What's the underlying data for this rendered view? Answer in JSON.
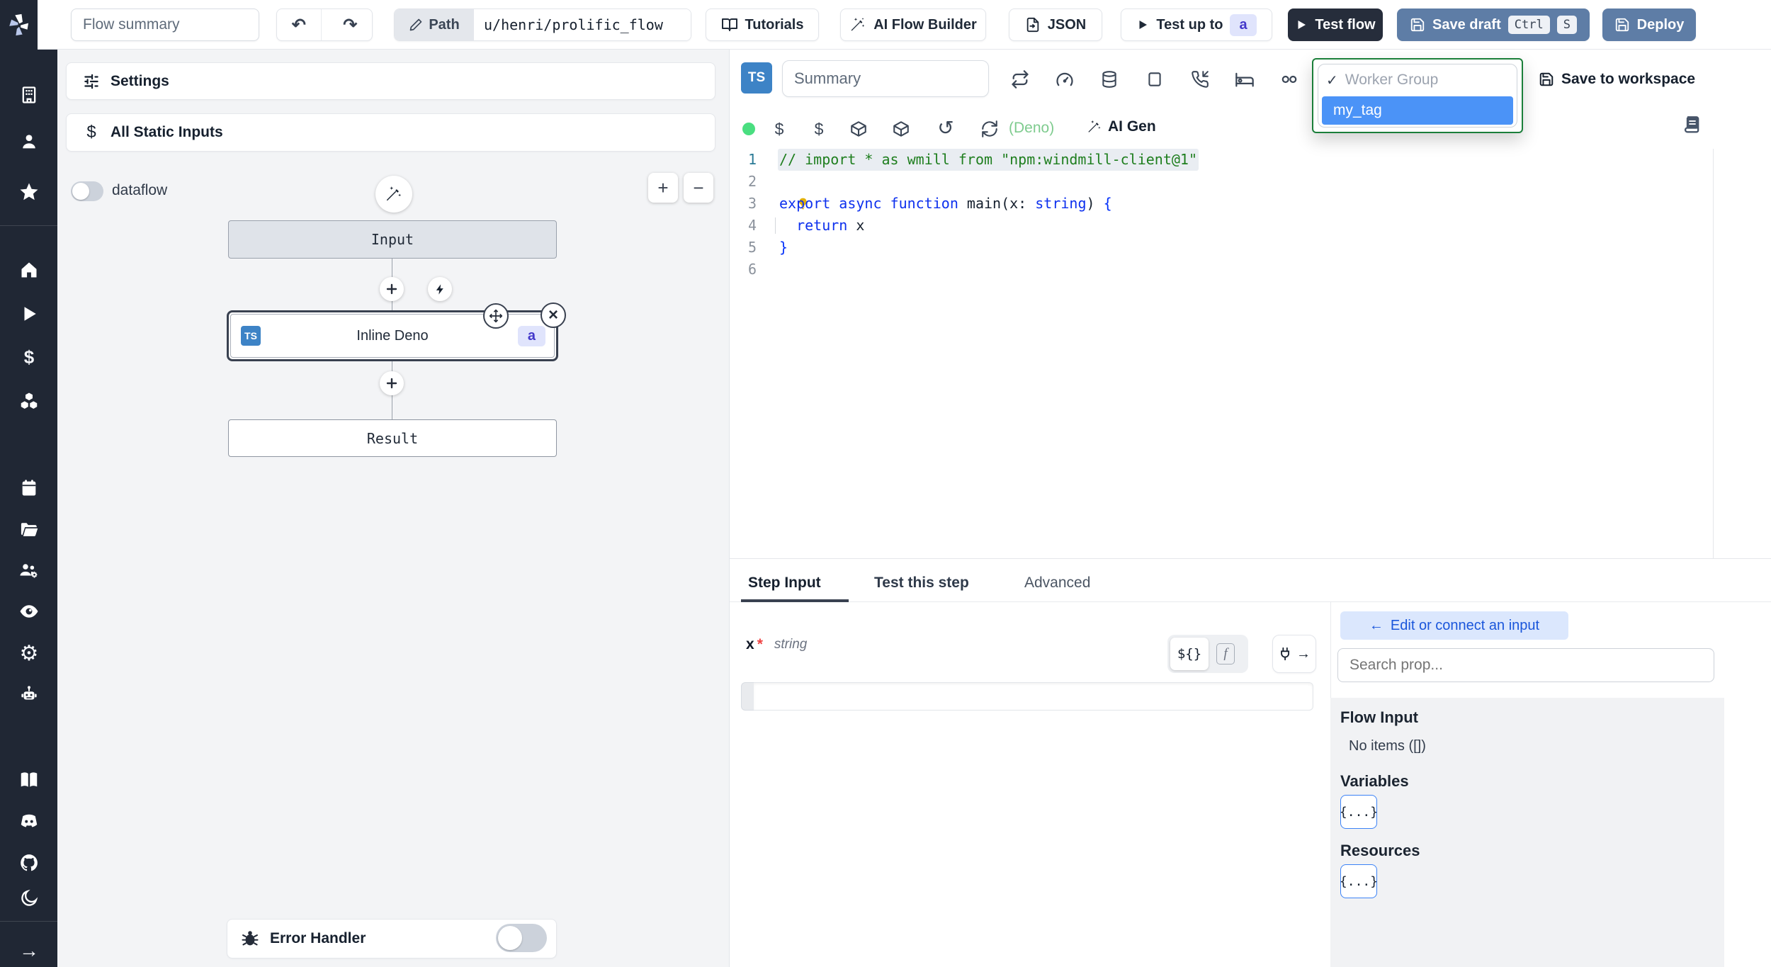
{
  "glyphs": {
    "undo": "↶",
    "redo": "↷",
    "check": "✓",
    "arrow_left": "←",
    "arrow_right": "→",
    "close": "×",
    "dollar": "$",
    "gear": "⚙",
    "moon": "☾",
    "rotate_ccw": "↺",
    "plus": "+",
    "minus": "−"
  },
  "topbar": {
    "flow_summary_placeholder": "Flow summary",
    "path_label": "Path",
    "path_value": "u/henri/prolific_flow",
    "tutorials": "Tutorials",
    "ai_flow_builder": "AI Flow Builder",
    "json": "JSON",
    "test_up_to": "Test up to",
    "test_up_to_badge": "a",
    "test_flow": "Test flow",
    "save_draft": "Save draft",
    "kbd_ctrl": "Ctrl",
    "kbd_s": "S",
    "deploy": "Deploy"
  },
  "sidebar": {
    "icon_names": [
      "windmill-logo",
      "building",
      "user",
      "star",
      "home",
      "play",
      "dollar",
      "boxes",
      "calendar",
      "folder",
      "user-group-gear",
      "eye",
      "gear",
      "robot",
      "book",
      "discord",
      "github",
      "moon",
      "expand-arrow"
    ]
  },
  "flow": {
    "settings": "Settings",
    "all_static_inputs": "All Static Inputs",
    "dataflow_label": "dataflow",
    "input_node": "Input",
    "deno_node": "Inline Deno",
    "deno_lang_badge": "TS",
    "deno_badge": "a",
    "result_node": "Result",
    "error_handler": "Error Handler"
  },
  "editor": {
    "lang_badge": "TS",
    "summary_placeholder": "Summary",
    "dropdown": {
      "group": "Worker Group",
      "selected": "my_tag"
    },
    "save_to_workspace": "Save to workspace",
    "lang_hint": "(Deno)",
    "ai_gen": "AI Gen",
    "code": {
      "lines": [
        {
          "n": "1",
          "active": true,
          "sel": true,
          "tokens": [
            {
              "t": "// import * as wmill from \"npm:windmill-client@1\"",
              "c": "cmt"
            }
          ]
        },
        {
          "n": "2",
          "bulb": true,
          "tokens": []
        },
        {
          "n": "3",
          "tokens": [
            {
              "t": "export",
              "c": "kw"
            },
            {
              "t": " ",
              "c": "tx"
            },
            {
              "t": "async",
              "c": "kw"
            },
            {
              "t": " ",
              "c": "tx"
            },
            {
              "t": "function",
              "c": "kw"
            },
            {
              "t": " main(x: ",
              "c": "tx"
            },
            {
              "t": "string",
              "c": "kw"
            },
            {
              "t": ") ",
              "c": "tx"
            },
            {
              "t": "{",
              "c": "br"
            }
          ]
        },
        {
          "n": "4",
          "guide": true,
          "tokens": [
            {
              "t": "  ",
              "c": "tx"
            },
            {
              "t": "return",
              "c": "kw"
            },
            {
              "t": " x",
              "c": "tx"
            }
          ]
        },
        {
          "n": "5",
          "tokens": [
            {
              "t": "}",
              "c": "br"
            }
          ]
        },
        {
          "n": "6",
          "tokens": []
        }
      ]
    }
  },
  "bottom": {
    "tabs": [
      {
        "label": "Step Input"
      },
      {
        "label": "Test this step"
      },
      {
        "label": "Advanced"
      }
    ],
    "field": {
      "name": "x",
      "required": "*",
      "type": "string"
    },
    "toggle_template": "${}",
    "toggle_fn": "f",
    "right": {
      "edit_connect": "Edit or connect an input",
      "search_placeholder": "Search prop...",
      "flow_input": "Flow Input",
      "no_items": "No items ([])",
      "variables": "Variables",
      "resources": "Resources",
      "object_chip": "{...}"
    }
  },
  "colors": {
    "sidebar_bg": "#202734",
    "accent_blue": "#5e7da6",
    "dark_button": "#262d3b",
    "selected_row_blue": "#4b93f7",
    "dropdown_border_green": "#1b7f3a",
    "badge_bg": "#e0e4fc",
    "badge_text": "#4338ca",
    "ts_badge_blue": "#3d83c6",
    "status_dot_green": "#4ade80",
    "deno_hint_green": "#7ecb8e"
  }
}
